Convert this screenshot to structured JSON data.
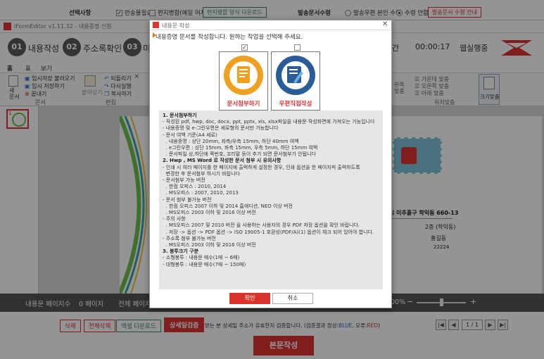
{
  "top_form": {
    "select_label": "선택사항",
    "opt_return": "반송불필요",
    "opt_mix": "편지병합(예일 머지)",
    "mix_download": "편지병합 양식 다운로드",
    "dispatch_label": "발송문서수령",
    "recv_opt1": "발송우편 본인 수령",
    "recv_opt2": "수령 안함",
    "recv_guide": "발송문서 수령 안내"
  },
  "app": {
    "title": "iFormEditor v1.11.32 - 내용증명 신청",
    "steps": [
      {
        "num": "01",
        "label": "내용작성"
      },
      {
        "num": "02",
        "label": "주소록확인"
      },
      {
        "num": "03",
        "label": "미"
      }
    ],
    "step_right": "간",
    "timer": "00:00:17",
    "header_right": "웹실행중",
    "ribbon_tabs": [
      "홈",
      "표",
      "보기"
    ],
    "ribbon": {
      "new": "새\n문서",
      "temp_load": "임시저장 불러오기",
      "temp_save": "임시 저장하기",
      "close": "끝내기",
      "group_doc": "문서",
      "paste": "붙여넣기",
      "undo": "되돌리기",
      "redo": "다시실행",
      "copy": "복사하기",
      "group_edit": "편집",
      "center": "가운데 맞춤",
      "right_align": "오른쪽 맞춤",
      "bottom_align": "아래 맞춤",
      "left_col": "왼쪽\n맞춤",
      "group_pos": "위치맞춤",
      "fit_size": "크기맞춤"
    },
    "page_info": {
      "thumb_number": "1"
    },
    "canvas": {
      "addr_line1": "시 미추홀구 학익동 660-13",
      "addr_line2": "2층 (학익동)",
      "name": "홍길동",
      "zip": "22224"
    },
    "status": {
      "pages_label": "내용문 페이지수",
      "pages_value": "0 페이지",
      "total_label": "전체 페이지",
      "zoom": "00%"
    }
  },
  "bottom": {
    "delete": "삭제",
    "delete_all": "전체삭제",
    "excel": "엑셀 다운로드",
    "verify": "상세일검증",
    "verify_desc": "받는 분 상세일 주소가 유효한지 검증합니다. (검증결과 정상:",
    "normal": "BLUE",
    "error_sep": ", 오류:",
    "error": "RED",
    "close_paren": ")",
    "page": "1 / 1",
    "submit": "본문작성"
  },
  "dialog": {
    "title": "내용문 작성",
    "message": "내용증명 문서를 작성합니다. 원하는 작업을 선택해 주세요.",
    "option1": "문서첨부하기",
    "option2": "우편직접작성",
    "option1_checked": true,
    "option2_checked": false,
    "info": [
      {
        "text": "1. 문서첨부하기",
        "head": true
      },
      {
        "text": "- 작성된 pdf, hwp, doc, docx, ppt, pptx, xls, xlsx파일을 내용문 작성화면에 가져오는 기능입니다"
      },
      {
        "text": "- 내용증명 및 e-그린우편은 세로형의 문서만 가능합니다"
      },
      {
        "text": "- 문서 여백 기준(A4 세로)"
      },
      {
        "text": "  . 내용증명 : 상단 20mm, 좌측/우측 15mm, 하단 40mm 여백"
      },
      {
        "text": "  . e그린우편 : 상단 15mm, 좌측 15mm, 우측 5mm, 하단 15mm 여백"
      },
      {
        "text": "  . 문서파일 상,하단에 쪽번호, 꼬리말 등이 추가 되면 문서첨부가 안됩니다"
      },
      {
        "text": "2. Hwp , MS Word 로 작성한 문서 첨부 시 유의사항",
        "head": true
      },
      {
        "text": "- 인쇄 시 여러 페이지를 한 페이지에 출력하게 설정한 경우, 인쇄 옵션을 한 페이지씩 출력하도록"
      },
      {
        "text": "  변경한 후 문서첨부 하시기 바랍니다"
      },
      {
        "text": "- 문서첨부 가능 버전"
      },
      {
        "text": "  . 한컴 오피스 : 2010, 2014"
      },
      {
        "text": "  . MS오피스 : 2007, 2010, 2013"
      },
      {
        "text": "- 문서 첨부 불가능 버전"
      },
      {
        "text": "  . 한컴 오피스 2007 이하 및 2014 홈에디션, NEO 이상 버전"
      },
      {
        "text": "  . MS오피스 2003 이하 및 2016 이상 버전"
      },
      {
        "text": "- 주의 사항"
      },
      {
        "text": "  . MS오피스 2007 및 2010 버전 을 사용하는 사용자의 경우 PDF 저장 옵션을 확인 바랍니다."
      },
      {
        "text": "  . 저장 -> 옵션 -> PDF 옵션 -> ISO 19005-1 호환성(PDF/A)(1) 옵션이 체크 되어 있어야 합니다."
      },
      {
        "text": "- 주소록 첨부 불가능 버전"
      },
      {
        "text": "  . MS오피스 2003 이하 및 2016 이상 버전"
      },
      {
        "text": "3. 봉투크기 구분",
        "head": true
      },
      {
        "text": "- 소형봉투 : 내용문 매수(1매 ~ 6매)"
      },
      {
        "text": "- 대형봉투 : 내용문 매수(7매 ~ 150매)"
      }
    ],
    "confirm": "확인",
    "cancel": "취소"
  }
}
